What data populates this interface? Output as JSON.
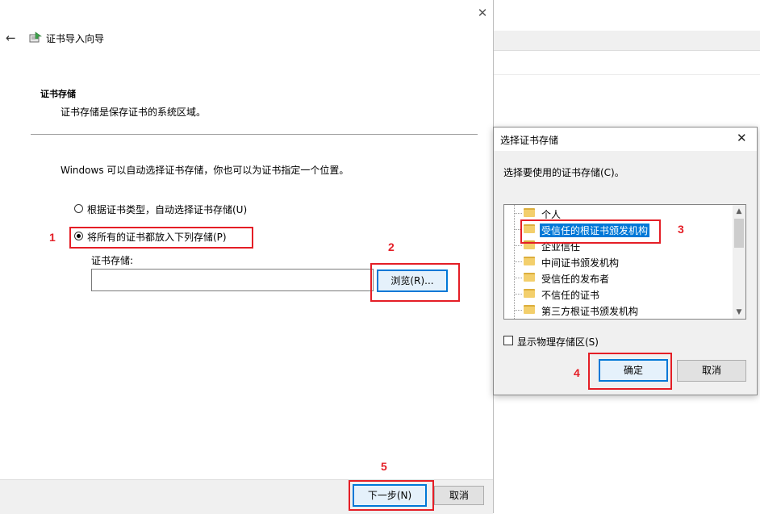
{
  "wizard": {
    "title": "证书导入向导",
    "section_heading": "证书存储",
    "section_description": "证书存储是保存证书的系统区域。",
    "intro": "Windows 可以自动选择证书存储，你也可以为证书指定一个位置。",
    "radio_auto_label": "根据证书类型，自动选择证书存储(U)",
    "radio_manual_label": "将所有的证书都放入下列存储(P)",
    "radio_selected": "manual",
    "store_field_label": "证书存储:",
    "store_field_value": "",
    "browse_button": "浏览(R)...",
    "next_button": "下一步(N)",
    "cancel_button": "取消"
  },
  "dialog": {
    "title": "选择证书存储",
    "prompt": "选择要使用的证书存储(C)。",
    "tree_items": [
      {
        "label": "个人",
        "selected": false
      },
      {
        "label": "受信任的根证书颁发机构",
        "selected": true
      },
      {
        "label": "企业信任",
        "selected": false
      },
      {
        "label": "中间证书颁发机构",
        "selected": false
      },
      {
        "label": "受信任的发布者",
        "selected": false
      },
      {
        "label": "不信任的证书",
        "selected": false
      },
      {
        "label": "第三方根证书颁发机构",
        "selected": false
      }
    ],
    "show_physical_label": "显示物理存储区(S)",
    "show_physical_checked": false,
    "ok_button": "确定",
    "cancel_button": "取消"
  },
  "annotations": {
    "step1": "1",
    "step2": "2",
    "step3": "3",
    "step4": "4",
    "step5": "5",
    "color": "#e41e26"
  },
  "icons": {
    "back": "back-arrow-icon",
    "wizard": "certificate-icon",
    "close": "close-icon",
    "folder": "folder-icon"
  }
}
